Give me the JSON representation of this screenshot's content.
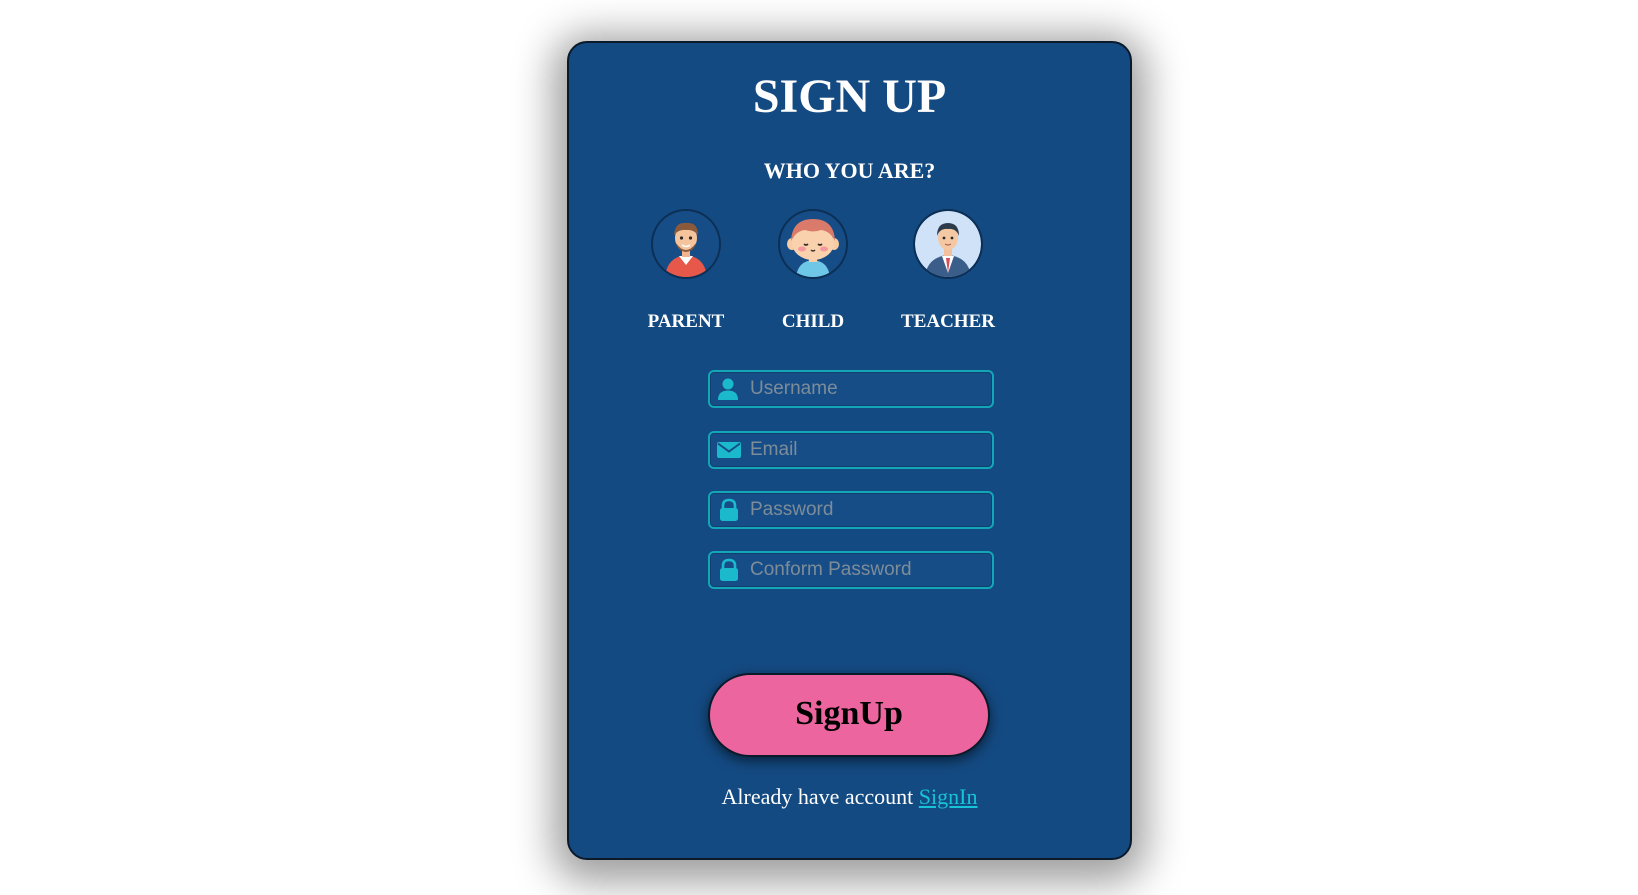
{
  "form": {
    "title": "SIGN UP",
    "subtitle": "WHO YOU ARE?",
    "roles": [
      {
        "label": "PARENT",
        "icon": "parent-avatar-icon"
      },
      {
        "label": "CHILD",
        "icon": "child-avatar-icon"
      },
      {
        "label": "TEACHER",
        "icon": "teacher-avatar-icon"
      }
    ],
    "fields": {
      "username": {
        "placeholder": "Username",
        "value": "",
        "icon": "user-icon"
      },
      "email": {
        "placeholder": "Email",
        "value": "",
        "icon": "envelope-icon"
      },
      "password": {
        "placeholder": "Password",
        "value": "",
        "icon": "lock-icon"
      },
      "confirm_password": {
        "placeholder": "Conform Password",
        "value": "",
        "icon": "lock-icon"
      }
    },
    "submit_label": "SignUp",
    "footer_text": "Already have account",
    "footer_link": "SignIn"
  },
  "colors": {
    "card_background": "#144a82",
    "field_border": "#12a6b8",
    "icon_accent": "#1ab9cc",
    "button_background": "#ec659f",
    "link": "#17c3d6"
  }
}
